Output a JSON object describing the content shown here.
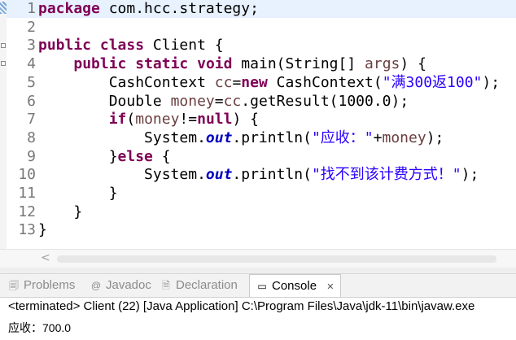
{
  "editor": {
    "lines": [
      {
        "n": "1",
        "tokens": [
          {
            "t": "package",
            "c": "kw"
          },
          {
            "t": " com.hcc.strategy;",
            "c": ""
          }
        ]
      },
      {
        "n": "2",
        "tokens": []
      },
      {
        "n": "3",
        "tokens": [
          {
            "t": "public",
            "c": "kw"
          },
          {
            "t": " ",
            "c": ""
          },
          {
            "t": "class",
            "c": "kw"
          },
          {
            "t": " Client {",
            "c": ""
          }
        ]
      },
      {
        "n": "4",
        "tokens": [
          {
            "t": "    ",
            "c": ""
          },
          {
            "t": "public",
            "c": "kw"
          },
          {
            "t": " ",
            "c": ""
          },
          {
            "t": "static",
            "c": "kw"
          },
          {
            "t": " ",
            "c": ""
          },
          {
            "t": "void",
            "c": "kw"
          },
          {
            "t": " main(String[] ",
            "c": ""
          },
          {
            "t": "args",
            "c": "var"
          },
          {
            "t": ") {",
            "c": ""
          }
        ]
      },
      {
        "n": "5",
        "tokens": [
          {
            "t": "        CashContext ",
            "c": ""
          },
          {
            "t": "cc",
            "c": "var"
          },
          {
            "t": "=",
            "c": ""
          },
          {
            "t": "new",
            "c": "kw"
          },
          {
            "t": " CashContext(",
            "c": ""
          },
          {
            "t": "\"满300返100\"",
            "c": "str"
          },
          {
            "t": ");",
            "c": ""
          }
        ]
      },
      {
        "n": "6",
        "tokens": [
          {
            "t": "        Double ",
            "c": ""
          },
          {
            "t": "money",
            "c": "var"
          },
          {
            "t": "=",
            "c": ""
          },
          {
            "t": "cc",
            "c": "var"
          },
          {
            "t": ".getResult(1000.0);",
            "c": ""
          }
        ]
      },
      {
        "n": "7",
        "tokens": [
          {
            "t": "        ",
            "c": ""
          },
          {
            "t": "if",
            "c": "kw"
          },
          {
            "t": "(",
            "c": ""
          },
          {
            "t": "money",
            "c": "var"
          },
          {
            "t": "!=",
            "c": ""
          },
          {
            "t": "null",
            "c": "kw"
          },
          {
            "t": ") {",
            "c": ""
          }
        ]
      },
      {
        "n": "8",
        "tokens": [
          {
            "t": "            System.",
            "c": ""
          },
          {
            "t": "out",
            "c": "fld"
          },
          {
            "t": ".println(",
            "c": ""
          },
          {
            "t": "\"应收：\"",
            "c": "str"
          },
          {
            "t": "+",
            "c": ""
          },
          {
            "t": "money",
            "c": "var"
          },
          {
            "t": ");",
            "c": ""
          }
        ]
      },
      {
        "n": "9",
        "tokens": [
          {
            "t": "        }",
            "c": ""
          },
          {
            "t": "else",
            "c": "kw"
          },
          {
            "t": " {",
            "c": ""
          }
        ]
      },
      {
        "n": "10",
        "tokens": [
          {
            "t": "            System.",
            "c": ""
          },
          {
            "t": "out",
            "c": "fld"
          },
          {
            "t": ".println(",
            "c": ""
          },
          {
            "t": "\"找不到该计费方式！\"",
            "c": "str"
          },
          {
            "t": ");",
            "c": ""
          }
        ]
      },
      {
        "n": "11",
        "tokens": [
          {
            "t": "        }",
            "c": ""
          }
        ]
      },
      {
        "n": "12",
        "tokens": [
          {
            "t": "    }",
            "c": ""
          }
        ]
      },
      {
        "n": "13",
        "tokens": [
          {
            "t": "}",
            "c": ""
          }
        ]
      }
    ]
  },
  "scrollbar": {
    "left_arrow": "<"
  },
  "tabs": [
    {
      "label": "Problems",
      "icon": "problems-icon",
      "glyph": "🗐",
      "active": false
    },
    {
      "label": "Javadoc",
      "icon": "javadoc-icon",
      "glyph": "@",
      "active": false
    },
    {
      "label": "Declaration",
      "icon": "declaration-icon",
      "glyph": "🗎",
      "active": false
    },
    {
      "label": "Console",
      "icon": "console-icon",
      "glyph": "▭",
      "active": true
    }
  ],
  "console": {
    "close_glyph": "✕",
    "status": "<terminated> Client (22) [Java Application] C:\\Program Files\\Java\\jdk-11\\bin\\javaw.exe",
    "output": "应收：700.0"
  },
  "colors": {
    "keyword": "#7f0055",
    "string": "#2a00ff",
    "variable": "#6a3e3e",
    "field": "#0000c0",
    "current_line": "#e8f2fe"
  }
}
